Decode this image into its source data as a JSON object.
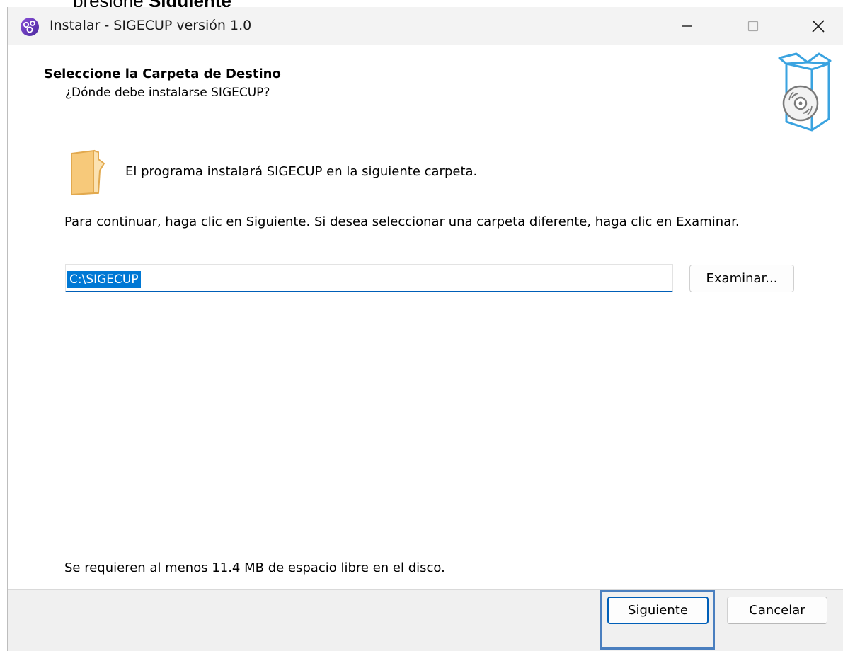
{
  "crop_text": {
    "prefix": "presione ",
    "bold": "Siguiente"
  },
  "titlebar": {
    "title": "Instalar - SIGECUP versión 1.0",
    "app_icon": "installer-app-icon",
    "minimize_icon": "minimize-icon",
    "maximize_icon": "maximize-icon",
    "close_icon": "close-icon"
  },
  "header": {
    "title": "Seleccione la Carpeta de Destino",
    "subtitle": "¿Dónde debe instalarse SIGECUP?",
    "icon": "software-box-cd-icon"
  },
  "content": {
    "folder_icon": "folder-icon",
    "install_text": "El programa instalará SIGECUP en la siguiente carpeta.",
    "instructions": "Para continuar, haga clic en Siguiente. Si desea seleccionar una carpeta diferente, haga clic en Examinar.",
    "path_value": "C:\\SIGECUP",
    "browse_label": "Examinar...",
    "space_text": "Se requieren al menos 11.4 MB de espacio libre en el disco."
  },
  "footer": {
    "next_label": "Siguiente",
    "cancel_label": "Cancelar"
  },
  "colors": {
    "accent": "#005fb8",
    "selection": "#0078d4",
    "highlight_frame": "#4a7fbf",
    "folder": "#f7c97a"
  }
}
